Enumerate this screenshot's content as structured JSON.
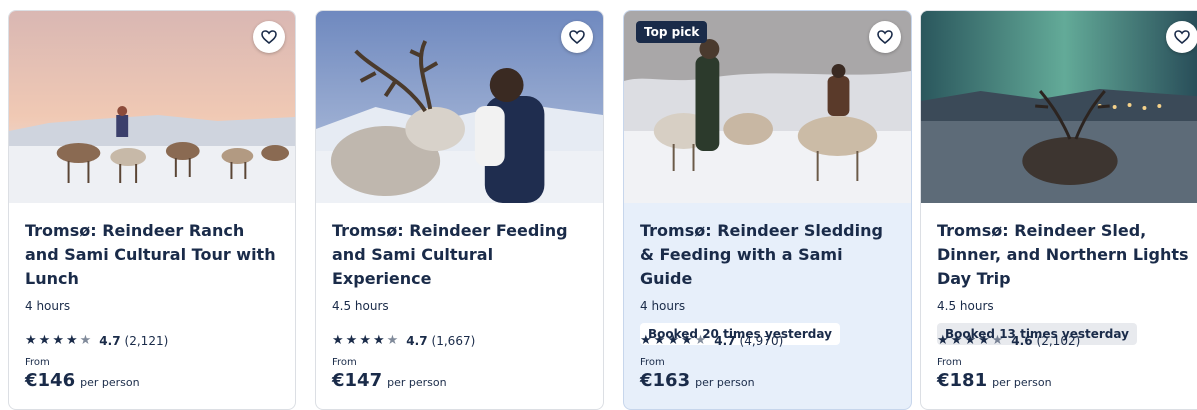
{
  "cards": [
    {
      "title": "Tromsø: Reindeer Ranch and Sami Cultural Tour with Lunch",
      "duration": "4 hours",
      "booked": "",
      "top_pick": "",
      "stars_icon": "star-icon",
      "rating": "4.7",
      "reviews": "(2,121)",
      "from_label": "From",
      "price": "€146",
      "per_label": "per person"
    },
    {
      "title": "Tromsø: Reindeer Feeding and Sami Cultural Experience",
      "duration": "4.5 hours",
      "booked": "",
      "top_pick": "",
      "rating": "4.7",
      "reviews": "(1,667)",
      "from_label": "From",
      "price": "€147",
      "per_label": "per person"
    },
    {
      "title": "Tromsø: Reindeer Sledding & Feeding with a Sami Guide",
      "duration": "4 hours",
      "booked": "Booked 20 times yesterday",
      "top_pick": "Top pick",
      "rating": "4.7",
      "reviews": "(4,970)",
      "from_label": "From",
      "price": "€163",
      "per_label": "per person"
    },
    {
      "title": "Tromsø: Reindeer Sled, Dinner, and Northern Lights Day Trip",
      "duration": "4.5 hours",
      "booked": "Booked 13 times yesterday",
      "top_pick": "",
      "rating": "4.6",
      "reviews": "(2,102)",
      "from_label": "From",
      "price": "€181",
      "per_label": "per person"
    }
  ],
  "colors": {
    "text": "#1a2b49",
    "highlight_bg": "#e7effa",
    "booked_bg": "#e8eaee"
  },
  "icons": {
    "wishlist": "heart-outline-icon",
    "star": "star-icon",
    "half_star": "half-star-icon"
  }
}
